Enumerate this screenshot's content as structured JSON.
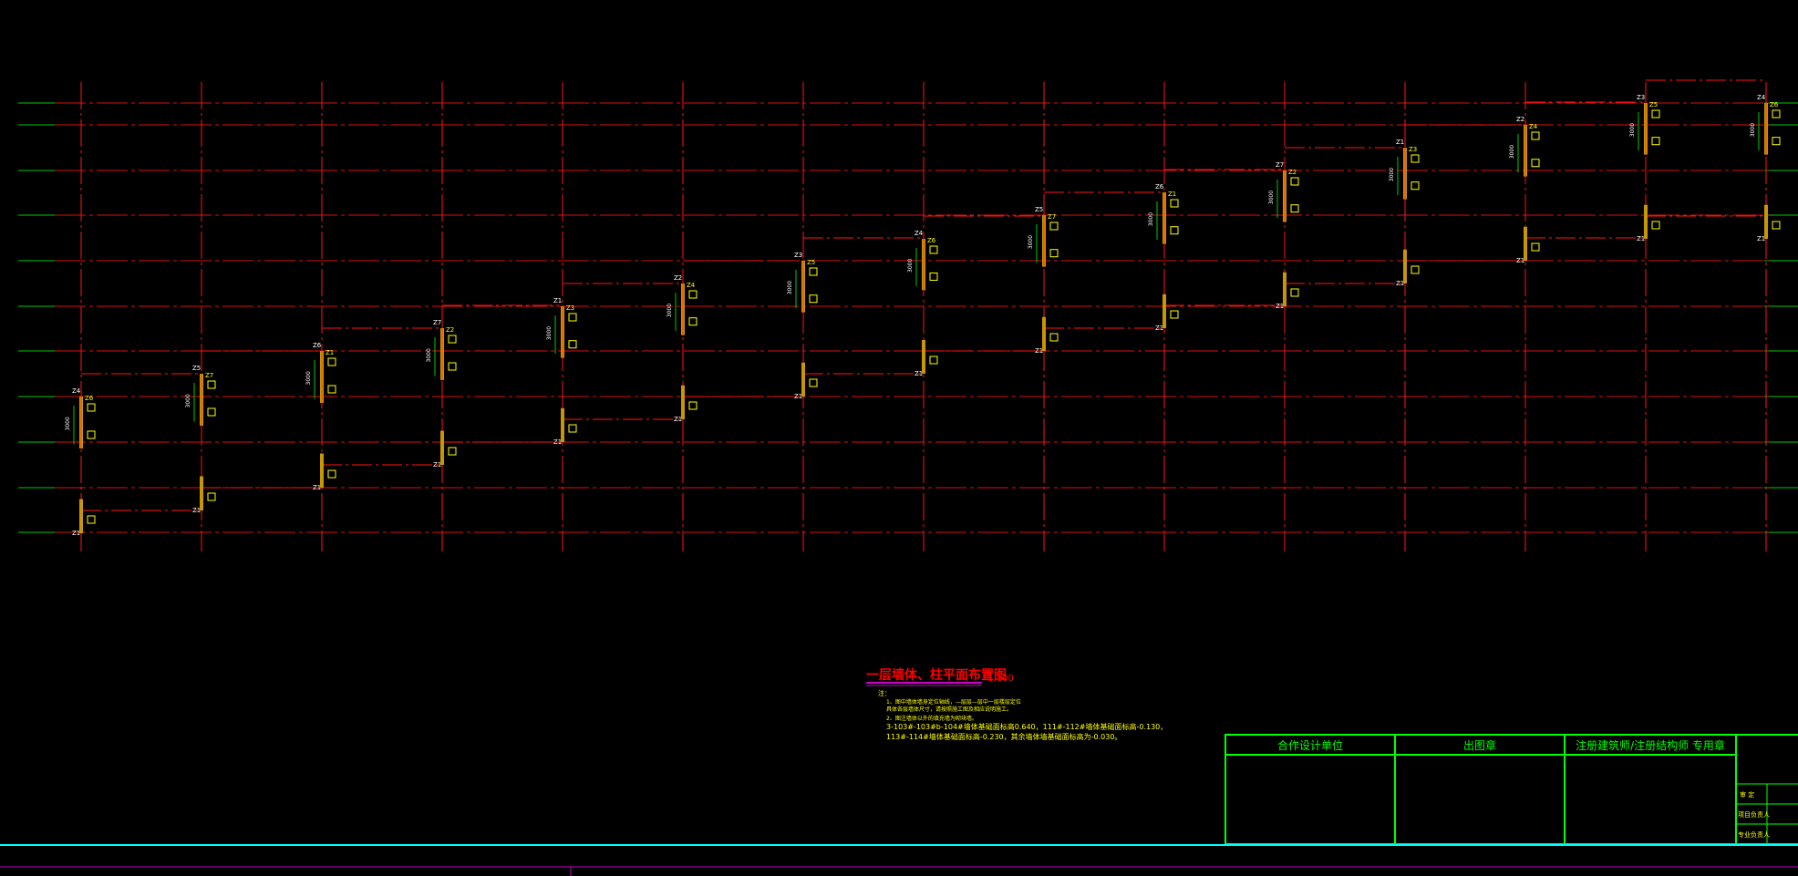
{
  "drawing": {
    "title": "一层墙体、柱平面布置图",
    "scale": "1:100",
    "notes_header": "注：",
    "notes": [
      "1、图中墙体墙身定位轴线，—层层—层中一层楼层定位",
      "   具体各层墙体尺寸，请按照施工图及相应说明施工。",
      "2、图注墙体以外的填充墙为砌块墙。",
      "3-103#-103#b-104#墙体基础面标高0.640，111#-112#墙体基础面标高-0.130，",
      "   113#-114#墙体基础面标高-0.230，其余墙体墙基础面标高为-0.030。"
    ],
    "wall_label": "3000",
    "axis_labels": [
      "Z1",
      "Z2",
      "Z3",
      "Z4",
      "Z5",
      "Z6",
      "Z7"
    ],
    "colors": {
      "background": "#000000",
      "axis_line": "#ff1414",
      "axis_stub": "#00c800",
      "wall": "#c89600",
      "wall_core": "#ff3c00",
      "dim_line": "#00c800",
      "label": "#ffffff",
      "title": "#ff0000",
      "title_underline": "#c800c8",
      "notes": "#ffff00",
      "title_block": "#00ff00",
      "bottom_rule": "#00ffff"
    }
  },
  "title_block": {
    "col1": "合作设计单位",
    "col2": "出图章",
    "col3": "注册建筑师/注册结构师  专用章",
    "rows": [
      "审  定",
      "项目负责人",
      "专业负责人"
    ]
  }
}
